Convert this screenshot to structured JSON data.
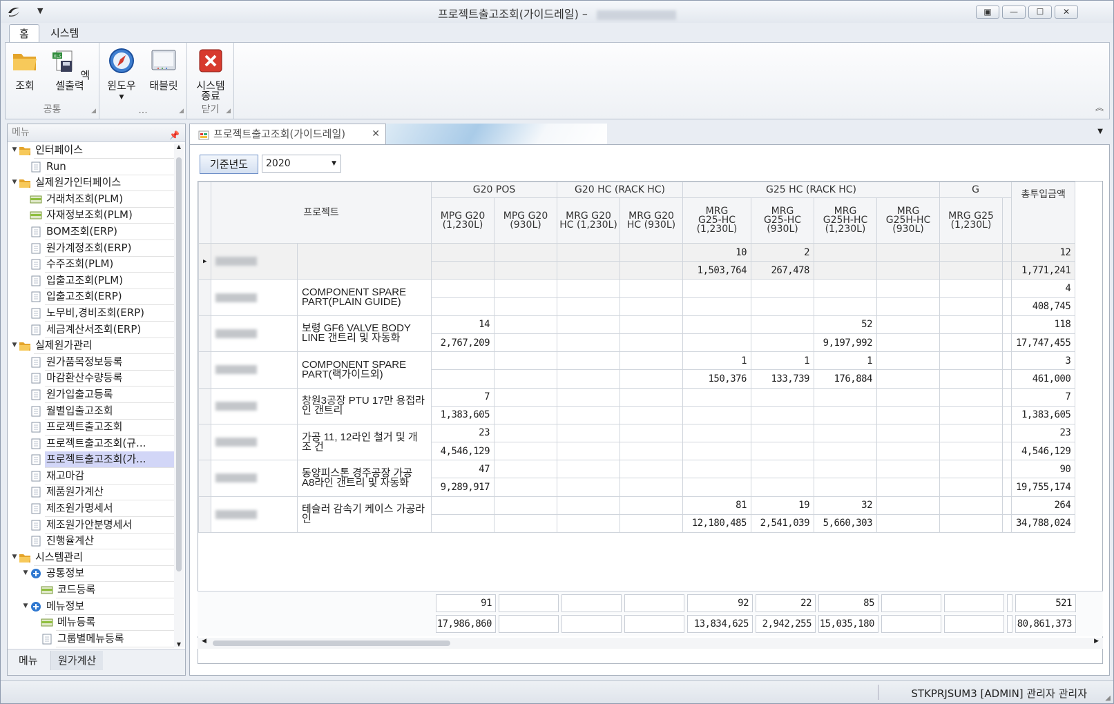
{
  "window": {
    "title": "프로젝트출고조회(가이드레일)"
  },
  "ribbon_tabs": [
    "홈",
    "시스템"
  ],
  "ribbon": {
    "groups": [
      {
        "label": "공통",
        "buttons": [
          {
            "label": "조회",
            "icon": "folder-open-icon"
          },
          {
            "label": "엑셀출력",
            "icon": "excel-export-icon"
          }
        ]
      },
      {
        "label": "...",
        "buttons": [
          {
            "label": "윈도우",
            "icon": "compass-icon"
          },
          {
            "label": "태블릿",
            "icon": "tablet-icon"
          }
        ]
      },
      {
        "label": "닫기",
        "buttons": [
          {
            "label": "시스템\n종료",
            "icon": "close-red-icon"
          }
        ]
      }
    ]
  },
  "sidebar": {
    "title": "메뉴",
    "tree": [
      {
        "label": "인터페이스",
        "level": 0,
        "type": "folder",
        "expanded": true
      },
      {
        "label": "Run",
        "level": 1,
        "type": "doc"
      },
      {
        "label": "실제원가인터페이스",
        "level": 0,
        "type": "folder",
        "expanded": true
      },
      {
        "label": "거래처조회(PLM)",
        "level": 1,
        "type": "grid"
      },
      {
        "label": "자재정보조회(PLM)",
        "level": 1,
        "type": "grid"
      },
      {
        "label": "BOM조회(ERP)",
        "level": 1,
        "type": "doc"
      },
      {
        "label": "원가계정조회(ERP)",
        "level": 1,
        "type": "doc"
      },
      {
        "label": "수주조회(PLM)",
        "level": 1,
        "type": "doc"
      },
      {
        "label": "입출고조회(PLM)",
        "level": 1,
        "type": "doc"
      },
      {
        "label": "입출고조회(ERP)",
        "level": 1,
        "type": "doc"
      },
      {
        "label": "노무비,경비조회(ERP)",
        "level": 1,
        "type": "doc"
      },
      {
        "label": "세금계산서조회(ERP)",
        "level": 1,
        "type": "doc"
      },
      {
        "label": "실제원가관리",
        "level": 0,
        "type": "folder",
        "expanded": true
      },
      {
        "label": "원가품목정보등록",
        "level": 1,
        "type": "doc"
      },
      {
        "label": "마감환산수량등록",
        "level": 1,
        "type": "doc"
      },
      {
        "label": "원가입출고등록",
        "level": 1,
        "type": "doc"
      },
      {
        "label": "월별입출고조회",
        "level": 1,
        "type": "doc"
      },
      {
        "label": "프로젝트출고조회",
        "level": 1,
        "type": "doc"
      },
      {
        "label": "프로젝트출고조회(규...",
        "level": 1,
        "type": "doc"
      },
      {
        "label": "프로젝트출고조회(가...",
        "level": 1,
        "type": "doc",
        "selected": true
      },
      {
        "label": "재고마감",
        "level": 1,
        "type": "doc"
      },
      {
        "label": "제품원가계산",
        "level": 1,
        "type": "doc"
      },
      {
        "label": "제조원가명세서",
        "level": 1,
        "type": "doc"
      },
      {
        "label": "제조원가안분명세서",
        "level": 1,
        "type": "doc"
      },
      {
        "label": "진행율계산",
        "level": 1,
        "type": "doc"
      },
      {
        "label": "시스템관리",
        "level": 0,
        "type": "folder",
        "expanded": true
      },
      {
        "label": "공통정보",
        "level": 1,
        "type": "plus",
        "expanded": true
      },
      {
        "label": "코드등록",
        "level": 2,
        "type": "grid"
      },
      {
        "label": "메뉴정보",
        "level": 1,
        "type": "plus",
        "expanded": true
      },
      {
        "label": "메뉴등록",
        "level": 2,
        "type": "grid"
      },
      {
        "label": "그룹별메뉴등록",
        "level": 2,
        "type": "doc"
      }
    ],
    "bottom_tabs": [
      "메뉴",
      "원가계산"
    ]
  },
  "doc_tab": {
    "label": "프로젝트출고조회(가이드레일)"
  },
  "filter": {
    "label": "기준년도",
    "value": "2020"
  },
  "grid": {
    "group_headers": [
      {
        "label": "G20 POS",
        "span": 2
      },
      {
        "label": "G20 HC (RACK HC)",
        "span": 2
      },
      {
        "label": "G25 HC (RACK HC)",
        "span": 4
      },
      {
        "label": "G",
        "span": 2
      }
    ],
    "project_header": "프로젝트",
    "total_header": "총투입금액",
    "columns": [
      "MPG G20\n(1,230L)",
      "MPG G20\n(930L)",
      "MRG G20\nHC (1,230L)",
      "MRG G20\nHC (930L)",
      "MRG\nG25-HC\n(1,230L)",
      "MRG\nG25-HC\n(930L)",
      "MRG\nG25H-HC\n(1,230L)",
      "MRG\nG25H-HC\n(930L)",
      "MRG G25\n(1,230L)",
      ""
    ],
    "rows": [
      {
        "name": "",
        "qty": [
          "",
          "",
          "",
          "",
          "10",
          "2",
          "",
          "",
          "",
          ""
        ],
        "amt": [
          "",
          "",
          "",
          "",
          "1,503,764",
          "267,478",
          "",
          "",
          "",
          ""
        ],
        "total_qty": "12",
        "total_amt": "1,771,241"
      },
      {
        "name": "COMPONENT SPARE PART(PLAIN GUIDE)",
        "qty": [
          "",
          "",
          "",
          "",
          "",
          "",
          "",
          "",
          "",
          ""
        ],
        "amt": [
          "",
          "",
          "",
          "",
          "",
          "",
          "",
          "",
          "",
          ""
        ],
        "total_qty": "4",
        "total_amt": "408,745"
      },
      {
        "name": "보령 GF6 VALVE BODY LINE 갠트리 및 자동화",
        "qty": [
          "14",
          "",
          "",
          "",
          "",
          "",
          "52",
          "",
          "",
          ""
        ],
        "amt": [
          "2,767,209",
          "",
          "",
          "",
          "",
          "",
          "9,197,992",
          "",
          "",
          ""
        ],
        "total_qty": "118",
        "total_amt": "17,747,455"
      },
      {
        "name": "COMPONENT SPARE PART(랙가이드외)",
        "qty": [
          "",
          "",
          "",
          "",
          "1",
          "1",
          "1",
          "",
          "",
          ""
        ],
        "amt": [
          "",
          "",
          "",
          "",
          "150,376",
          "133,739",
          "176,884",
          "",
          "",
          ""
        ],
        "total_qty": "3",
        "total_amt": "461,000"
      },
      {
        "name": "창원3공장 PTU 17만 용접라인 갠트리",
        "qty": [
          "7",
          "",
          "",
          "",
          "",
          "",
          "",
          "",
          "",
          ""
        ],
        "amt": [
          "1,383,605",
          "",
          "",
          "",
          "",
          "",
          "",
          "",
          "",
          ""
        ],
        "total_qty": "7",
        "total_amt": "1,383,605"
      },
      {
        "name": "가공 11, 12라인 철거 및 개조 건",
        "qty": [
          "23",
          "",
          "",
          "",
          "",
          "",
          "",
          "",
          "",
          ""
        ],
        "amt": [
          "4,546,129",
          "",
          "",
          "",
          "",
          "",
          "",
          "",
          "",
          ""
        ],
        "total_qty": "23",
        "total_amt": "4,546,129"
      },
      {
        "name": "동양피스톤 경주공장 가공 A8라인 갠트리 및 자동화",
        "qty": [
          "47",
          "",
          "",
          "",
          "",
          "",
          "",
          "",
          "",
          ""
        ],
        "amt": [
          "9,289,917",
          "",
          "",
          "",
          "",
          "",
          "",
          "",
          "",
          ""
        ],
        "total_qty": "90",
        "total_amt": "19,755,174"
      },
      {
        "name": "테슬러 감속기 케이스 가공라인",
        "qty": [
          "",
          "",
          "",
          "",
          "81",
          "19",
          "32",
          "",
          "",
          ""
        ],
        "amt": [
          "",
          "",
          "",
          "",
          "12,180,485",
          "2,541,039",
          "5,660,303",
          "",
          "",
          ""
        ],
        "total_qty": "264",
        "total_amt": "34,788,024"
      }
    ],
    "footer_qty": [
      "91",
      "",
      "",
      "",
      "92",
      "22",
      "85",
      "",
      "",
      ""
    ],
    "footer_amt": [
      "17,986,860",
      "",
      "",
      "",
      "13,834,625",
      "2,942,255",
      "15,035,180",
      "",
      "",
      ""
    ],
    "footer_total_qty": "521",
    "footer_total_amt": "80,861,373"
  },
  "status": {
    "text": "STKPRJSUM3   [ADMIN] 관리자 관리자"
  }
}
